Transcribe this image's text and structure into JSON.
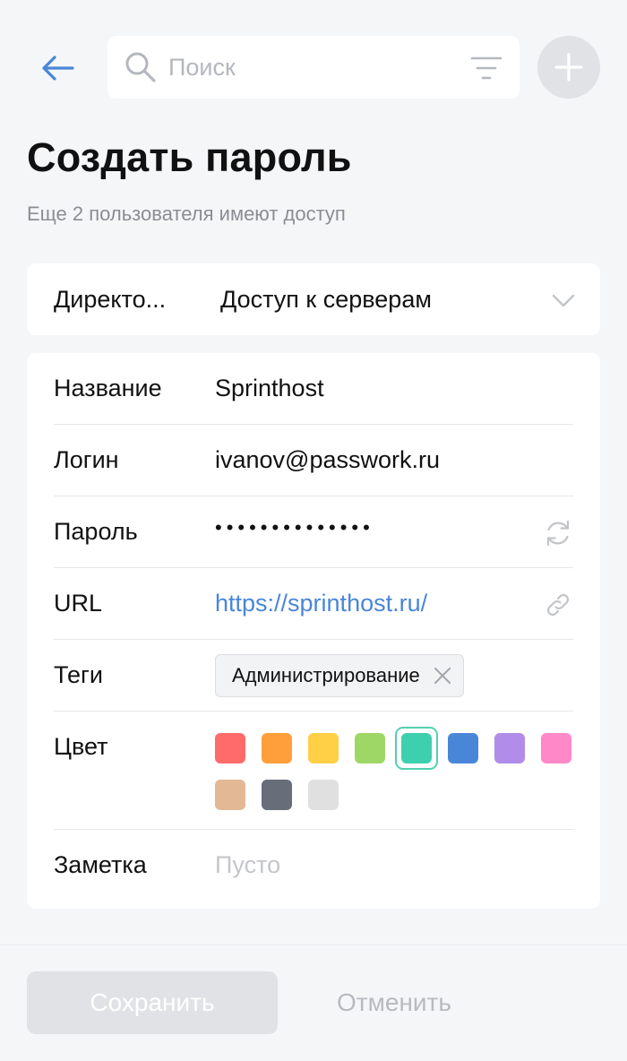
{
  "header": {
    "back_icon": "arrow-left-icon",
    "search_placeholder": "Поиск",
    "search_value": "",
    "search_icon": "search-icon",
    "filter_icon": "filter-icon",
    "add_icon": "plus-icon"
  },
  "page": {
    "title": "Создать пароль",
    "subtitle": "Еще 2 пользователя имеют доступ"
  },
  "directory": {
    "label": "Директо...",
    "value": "Доступ к серверам",
    "icon": "chevron-down-icon"
  },
  "form": {
    "name": {
      "label": "Название",
      "value": "Sprinthost"
    },
    "login": {
      "label": "Логин",
      "value": "ivanov@passwork.ru"
    },
    "password": {
      "label": "Пароль",
      "value": "••••••••••••••",
      "icon": "refresh-icon"
    },
    "url": {
      "label": "URL",
      "value": "https://sprinthost.ru/",
      "icon": "link-icon"
    },
    "tags": {
      "label": "Теги",
      "items": [
        {
          "label": "Администрирование"
        }
      ],
      "remove_icon": "close-icon"
    },
    "color": {
      "label": "Цвет",
      "selected": "#3ecfae",
      "swatches": [
        "#ff6b6b",
        "#ff9f3b",
        "#ffcf46",
        "#9ed765",
        "#3ecfae",
        "#4a86d8",
        "#b18ce8",
        "#ff88c8",
        "#e2b994",
        "#676d79",
        "#e0e0e0"
      ]
    },
    "note": {
      "label": "Заметка",
      "placeholder": "Пусто"
    }
  },
  "footer": {
    "save_label": "Сохранить",
    "cancel_label": "Отменить"
  },
  "colors": {
    "accent": "#4a86d8",
    "background": "#f5f6f8",
    "card": "#ffffff",
    "muted": "#b8babf"
  }
}
